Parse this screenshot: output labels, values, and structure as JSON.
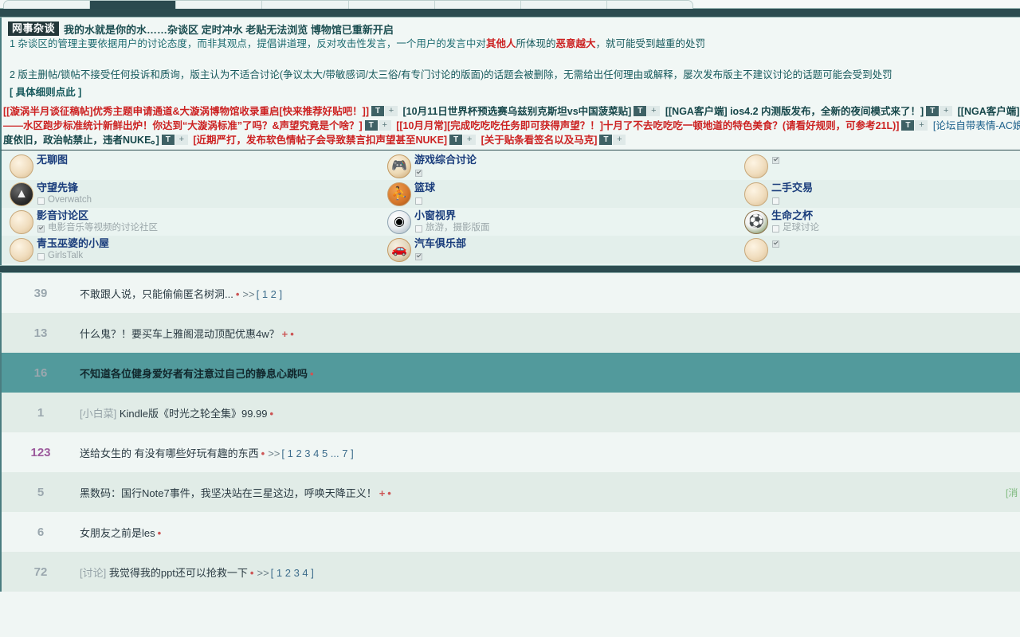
{
  "browser": {
    "tabs": [
      {
        "label": "",
        "active": false
      },
      {
        "label": "",
        "active": true
      },
      {
        "label": "",
        "active": false
      },
      {
        "label": "",
        "active": false
      },
      {
        "label": "",
        "active": false
      },
      {
        "label": "",
        "active": false
      },
      {
        "label": "",
        "active": false
      },
      {
        "label": "",
        "active": false
      }
    ]
  },
  "announcement": {
    "badge": "网事杂谈",
    "title": "我的水就是你的水……杂谈区 定时冲水 老贴无法浏览 博物馆已重新开启",
    "rule1_prefix": "1 杂谈区的管理主要依据用户的讨论态度，而非其观点，提倡讲道理，反对攻击性发言，一个用户的发言中对",
    "rule1_hot1": "其他人",
    "rule1_mid": "所体现的",
    "rule1_hot2": "恶意越大",
    "rule1_suffix": "，就可能受到越重的处罚",
    "rule2": "2 版主删帖/锁帖不接受任何投诉和质询，版主认为不适合讨论(争议太大/带敏感词/太三俗/有专门讨论的版面)的话题会被删除，无需给出任何理由或解释，屡次发布版主不建议讨论的话题可能会受到处罚",
    "detail_link": "[ 具体细则点此 ]"
  },
  "link_rows": [
    {
      "items": [
        {
          "text": "[[漩涡半月谈征稿帖]优秀主题申请通道&大漩涡博物馆收录重启[快来推荐好贴吧！]]",
          "style": "red",
          "tbtn": "T",
          "pbtn": "+"
        },
        {
          "text": "[10月11日世界杯预选赛乌兹别克斯坦vs中国菠菜贴]",
          "style": "dark",
          "tbtn": "T",
          "pbtn": "+"
        },
        {
          "text": "[[NGA客户端] ios4.2 内测版发布，全新的夜间模式来了！]",
          "style": "dark",
          "tbtn": "T",
          "pbtn": "+"
        },
        {
          "text": "[[NGA客户端] i",
          "style": "dark",
          "tbtn": "",
          "pbtn": ""
        }
      ]
    },
    {
      "items": [
        {
          "text": "——水区跑步标准统计新鲜出炉！你达到“大漩涡标准”了吗？&声望究竟是个啥？]",
          "style": "red",
          "tbtn": "T",
          "pbtn": "+"
        },
        {
          "text": "[[10月月常][完成吃吃吃任务即可获得声望？！]十月了不去吃吃吃一顿地道的特色美食？(请看好规则，可参考21L)]",
          "style": "red",
          "tbtn": "T",
          "pbtn": "+"
        },
        {
          "text": "[论坛自带表情-AC娘更",
          "style": "blue",
          "tbtn": "",
          "pbtn": ""
        }
      ]
    },
    {
      "items": [
        {
          "text": "度依旧，政治帖禁止，违者NUKE。]",
          "style": "dark",
          "tbtn": "T",
          "pbtn": "+"
        },
        {
          "text": "[近期严打，发布软色情帖子会导致禁言扣声望甚至NUKE]",
          "style": "red",
          "tbtn": "T",
          "pbtn": "+"
        },
        {
          "text": "[关于贴条看签名以及马克]",
          "style": "red",
          "tbtn": "T",
          "pbtn": "+"
        }
      ]
    }
  ],
  "boards": {
    "columns": [
      [
        {
          "name": "无聊图",
          "sub": "",
          "sub_state": "none",
          "icon": "paw-icon",
          "icon_style": "default",
          "glyph": "",
          "alt": false
        },
        {
          "name": "守望先锋",
          "sub": "Overwatch",
          "sub_state": "unchecked",
          "icon": "overwatch-icon",
          "icon_style": "dark",
          "glyph": "▲",
          "alt": true
        },
        {
          "name": "影音讨论区",
          "sub": "电影音乐等视频的讨论社区",
          "sub_state": "checked",
          "icon": "paw-icon",
          "icon_style": "default",
          "glyph": "",
          "alt": false
        },
        {
          "name": "青玉巫婆的小屋",
          "sub": "GirlsTalk",
          "sub_state": "unchecked",
          "icon": "paw-icon",
          "icon_style": "default",
          "glyph": "",
          "alt": true
        }
      ],
      [
        {
          "name": "游戏综合讨论",
          "sub": "",
          "sub_state": "checked",
          "icon": "gamepad-icon",
          "icon_style": "ctrl",
          "glyph": "🎮",
          "alt": false
        },
        {
          "name": "篮球",
          "sub": "",
          "sub_state": "unchecked",
          "icon": "basketball-icon",
          "icon_style": "orange",
          "glyph": "⛹",
          "alt": true
        },
        {
          "name": "小窗视界",
          "sub": "旅游，摄影版面",
          "sub_state": "unchecked",
          "icon": "camera-icon",
          "icon_style": "camera",
          "glyph": "◉",
          "alt": false
        },
        {
          "name": "汽车俱乐部",
          "sub": "",
          "sub_state": "checked",
          "icon": "car-icon",
          "icon_style": "car",
          "glyph": "🚗",
          "alt": true
        }
      ],
      [
        {
          "name": "",
          "sub": "",
          "sub_state": "checked",
          "icon": "paw-icon",
          "icon_style": "default",
          "glyph": "",
          "alt": false
        },
        {
          "name": "二手交易",
          "sub": "",
          "sub_state": "unchecked",
          "icon": "paw-icon",
          "icon_style": "default",
          "glyph": "",
          "alt": true
        },
        {
          "name": "生命之杯",
          "sub": "足球讨论",
          "sub_state": "unchecked",
          "icon": "soccer-icon",
          "icon_style": "soccer",
          "glyph": "⚽",
          "alt": false
        },
        {
          "name": "",
          "sub": "",
          "sub_state": "checked",
          "icon": "paw-icon",
          "icon_style": "default",
          "glyph": "",
          "alt": true
        }
      ]
    ]
  },
  "threads": [
    {
      "count": "39",
      "prefix": "",
      "title": "不敢跟人说，只能偷偷匿名树洞...",
      "dot": "•",
      "plus": "",
      "arrows": ">>",
      "pages": "[ 1 2 ]",
      "row": "normal",
      "right": ""
    },
    {
      "count": "13",
      "prefix": "",
      "title": "什么鬼？！要买车上雅阁混动顶配优惠4w？",
      "dot": "•",
      "plus": "+",
      "arrows": "",
      "pages": "",
      "row": "alt",
      "right": ""
    },
    {
      "count": "16",
      "prefix": "",
      "title": "不知道各位健身爱好者有注意过自己的静息心跳吗",
      "dot": "•",
      "plus": "",
      "arrows": "",
      "pages": "",
      "row": "sel",
      "right": ""
    },
    {
      "count": "1",
      "prefix": "[小白菜]",
      "title": "Kindle版《时光之轮全集》99.99",
      "dot": "•",
      "plus": "",
      "arrows": "",
      "pages": "",
      "row": "alt",
      "right": ""
    },
    {
      "count": "123",
      "prefix": "",
      "title": "送给女生的 有没有哪些好玩有趣的东西",
      "dot": "•",
      "plus": "",
      "arrows": ">>",
      "pages": "[ 1 2 3 4 5 ... 7 ]",
      "row": "normal",
      "right": "",
      "count_style": "hot"
    },
    {
      "count": "5",
      "prefix": "",
      "title": "黑数码：国行Note7事件，我坚决站在三星这边，呼唤天降正义！",
      "dot": "•",
      "plus": "+",
      "arrows": "",
      "pages": "",
      "row": "alt",
      "right": "[消"
    },
    {
      "count": "6",
      "prefix": "",
      "title": "女朋友之前是les",
      "dot": "•",
      "plus": "",
      "arrows": "",
      "pages": "",
      "row": "normal",
      "right": ""
    },
    {
      "count": "72",
      "prefix": "[讨论]",
      "title": "我觉得我的ppt还可以抢救一下",
      "dot": "•",
      "plus": "",
      "arrows": ">>",
      "pages": "[ 1 2 3 4 ]",
      "row": "alt",
      "right": ""
    }
  ],
  "colors": {
    "band_dark": "#2c4c50",
    "row_selected": "#529a9c",
    "row_alt": "#e1ece7",
    "row_normal": "#f0f6f4",
    "link_red": "#cc2222",
    "link_teal": "#1b6266",
    "board_name": "#1a3d7c"
  }
}
